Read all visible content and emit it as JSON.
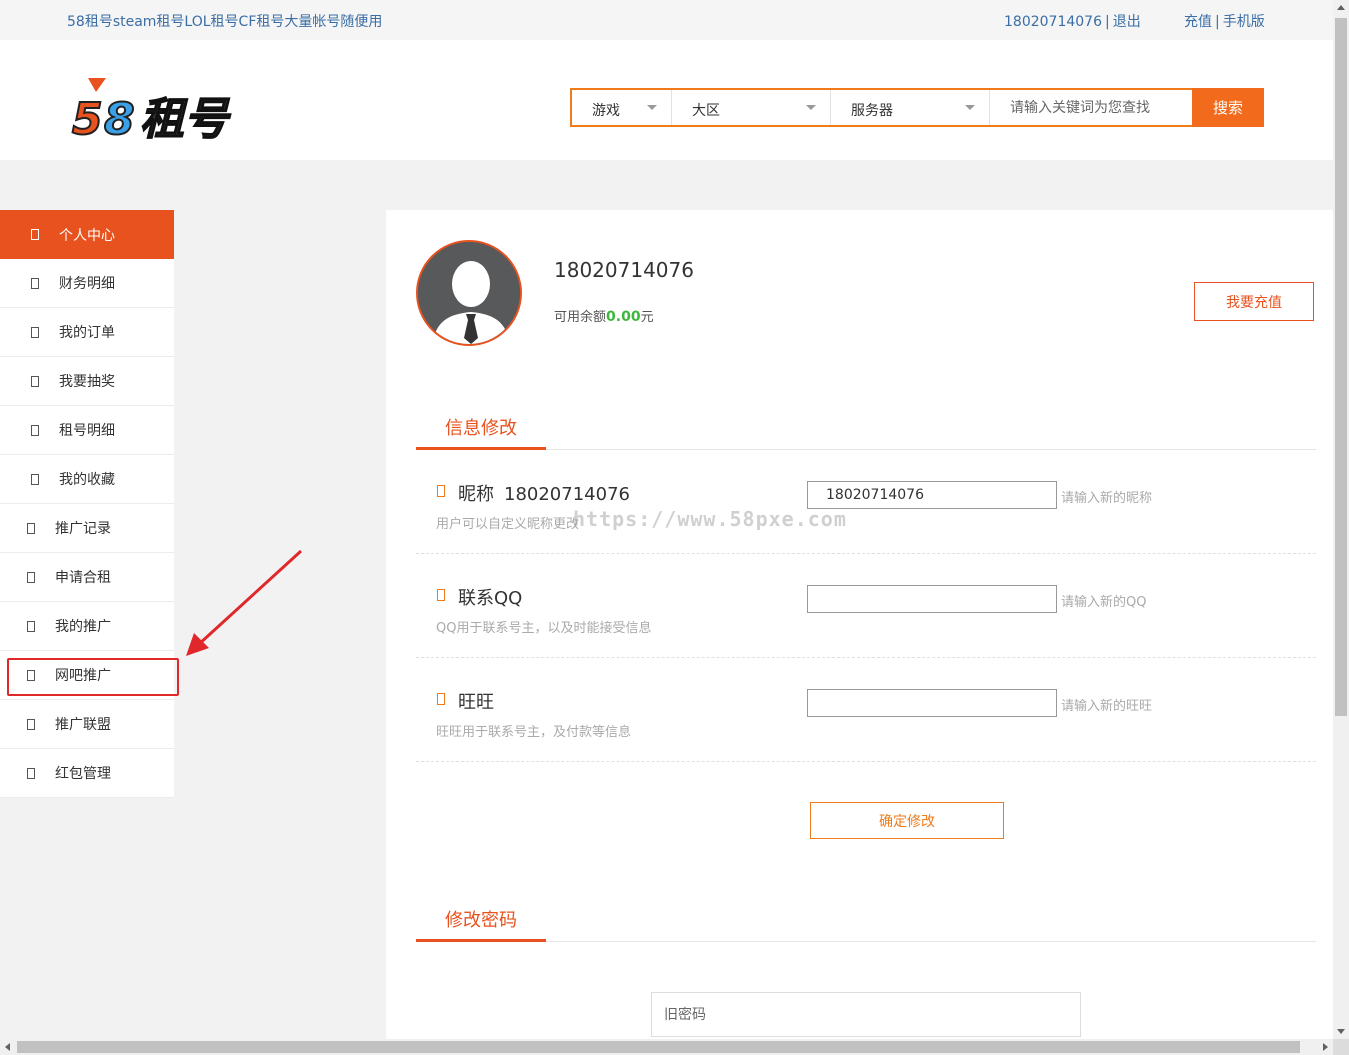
{
  "topbar": {
    "site_title": "58租号steam租号LOL租号CF租号大量帐号随便用",
    "phone": "18020714076",
    "logout": "退出",
    "recharge": "充值",
    "mobile": "手机版",
    "sep": "|"
  },
  "header": {
    "logo_text": "58租号",
    "search": {
      "game_label": "游戏",
      "region_label": "大区",
      "server_label": "服务器",
      "placeholder": "请输入关键词为您查找",
      "button": "搜索"
    }
  },
  "sidebar": {
    "items": [
      {
        "label": "个人中心"
      },
      {
        "label": "财务明细"
      },
      {
        "label": "我的订单"
      },
      {
        "label": "我要抽奖"
      },
      {
        "label": "租号明细"
      },
      {
        "label": "我的收藏"
      },
      {
        "label": "推广记录"
      },
      {
        "label": "申请合租"
      },
      {
        "label": "我的推广"
      },
      {
        "label": "网吧推广"
      },
      {
        "label": "推广联盟"
      },
      {
        "label": "红包管理"
      }
    ]
  },
  "profile": {
    "username": "18020714076",
    "balance_prefix": "可用余额",
    "balance_amount": "0.00",
    "balance_suffix": "元",
    "recharge_button": "我要充值"
  },
  "info_section": {
    "tab_title": "信息修改",
    "nickname": {
      "label": "昵称",
      "current": "18020714076",
      "hint": "用户可以自定义昵称更改",
      "input_value": "18020714076",
      "input_note": "请输入新的昵称"
    },
    "qq": {
      "label": "联系QQ",
      "hint": "QQ用于联系号主，以及时能接受信息",
      "input_value": "",
      "input_note": "请输入新的QQ"
    },
    "wangwang": {
      "label": "旺旺",
      "hint": "旺旺用于联系号主，及付款等信息",
      "input_value": "",
      "input_note": "请输入新的旺旺"
    },
    "confirm_button": "确定修改"
  },
  "password_section": {
    "tab_title": "修改密码",
    "old_password_placeholder": "旧密码"
  },
  "watermark": "https://www.58pxe.com",
  "colors": {
    "accent": "#e8521e",
    "search_border": "#f07b1d",
    "link": "#3a6ea5",
    "balance": "#3db83d",
    "annotation": "#e0282a"
  }
}
